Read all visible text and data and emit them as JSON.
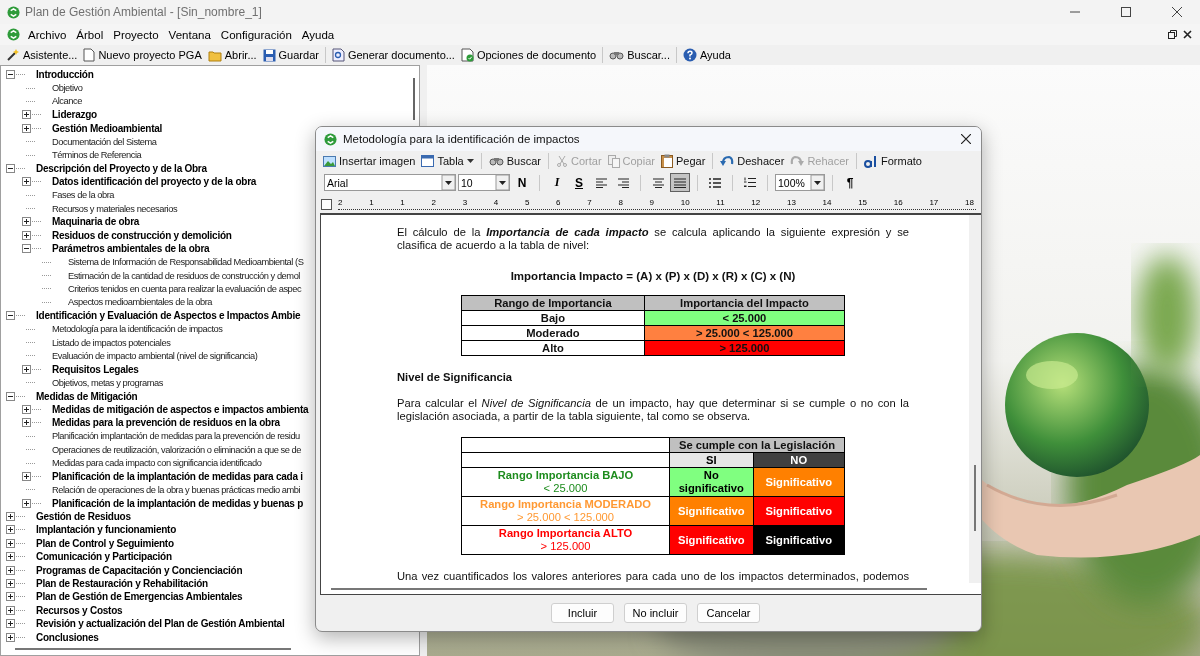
{
  "window": {
    "title": "Plan de Gestión Ambiental - [Sin_nombre_1]"
  },
  "menu": [
    "Archivo",
    "Árbol",
    "Proyecto",
    "Ventana",
    "Configuración",
    "Ayuda"
  ],
  "toolbar": [
    {
      "label": "Asistente...",
      "separator_before": false
    },
    {
      "label": "Nuevo proyecto PGA",
      "separator_before": false
    },
    {
      "label": "Abrir...",
      "separator_before": false
    },
    {
      "label": "Guardar",
      "separator_before": false
    },
    {
      "label": "Generar documento...",
      "separator_before": true
    },
    {
      "label": "Opciones de documento",
      "separator_before": false
    },
    {
      "label": "Buscar...",
      "separator_before": true
    },
    {
      "label": "Ayuda",
      "separator_before": true
    }
  ],
  "tree": [
    {
      "label": "Introducción",
      "expanded": true,
      "children": [
        {
          "label": "Objetivo"
        },
        {
          "label": "Alcance"
        },
        {
          "label": "Liderazgo",
          "expanded": false
        },
        {
          "label": "Gestión Medioambiental",
          "expanded": false
        },
        {
          "label": "Documentación del Sistema"
        },
        {
          "label": "Términos de Referencia"
        }
      ]
    },
    {
      "label": "Descripción del Proyecto y de la Obra",
      "expanded": true,
      "children": [
        {
          "label": "Datos identificación del proyecto y de la obra",
          "expanded": false
        },
        {
          "label": "Fases de la obra"
        },
        {
          "label": "Recursos y materiales necesarios"
        },
        {
          "label": "Maquinaria de obra",
          "expanded": false
        },
        {
          "label": "Residuos de construcción y demolición",
          "expanded": false
        },
        {
          "label": "Parámetros ambientales de la obra",
          "expanded": true,
          "children": [
            {
              "label": "Sistema de Información de Responsabilidad Medioambiental (S"
            },
            {
              "label": "Estimación de la cantidad de residuos de construcción y demol"
            },
            {
              "label": "Criterios tenidos en cuenta para realizar la evaluación de aspec"
            },
            {
              "label": "Aspectos medioambientales de la obra"
            }
          ]
        }
      ]
    },
    {
      "label": "Identificación y Evaluación de Aspectos e Impactos Ambie",
      "expanded": true,
      "children": [
        {
          "label": "Metodología para la identificación de impactos"
        },
        {
          "label": "Listado de impactos potenciales"
        },
        {
          "label": "Evaluación de impacto ambiental (nivel de significancia)"
        },
        {
          "label": "Requisitos Legales",
          "expanded": false
        },
        {
          "label": "Objetivos, metas y programas"
        }
      ]
    },
    {
      "label": "Medidas de Mitigación",
      "expanded": true,
      "children": [
        {
          "label": "Medidas de mitigación de aspectos e impactos ambienta",
          "expanded": false
        },
        {
          "label": "Medidas para la prevención de residuos en la obra",
          "expanded": false
        },
        {
          "label": "Planificación implantación de medidas para la prevención de residu"
        },
        {
          "label": "Operaciones de reutilización, valorización o eliminación a que se de"
        },
        {
          "label": "Medidas para cada impacto con significancia identificado"
        },
        {
          "label": "Planificación de la implantación de medidas para cada i",
          "expanded": false
        },
        {
          "label": "Relación de operaciones de la obra y buenas prácticas medio ambi"
        },
        {
          "label": "Planificación de la implantación de medidas y buenas p",
          "expanded": false
        }
      ]
    },
    {
      "label": "Gestión de Residuos",
      "expanded": false
    },
    {
      "label": "Implantación y funcionamiento",
      "expanded": false
    },
    {
      "label": "Plan de Control y Seguimiento",
      "expanded": false
    },
    {
      "label": "Comunicación y Participación",
      "expanded": false
    },
    {
      "label": "Programas de Capacitación y Concienciación",
      "expanded": false
    },
    {
      "label": "Plan de Restauración y Rehabilitación",
      "expanded": false
    },
    {
      "label": "Plan de Gestión de Emergencias Ambientales",
      "expanded": false
    },
    {
      "label": "Recursos y Costos",
      "expanded": false
    },
    {
      "label": "Revisión y actualización del Plan de Gestión Ambiental",
      "expanded": false
    },
    {
      "label": "Conclusiones",
      "expanded": false
    }
  ],
  "dialog": {
    "title": "Metodología para la identificación de impactos",
    "toolbar": [
      {
        "label": "Insertar imagen",
        "disabled": false,
        "dropdown": false,
        "separator_before": false
      },
      {
        "label": "Tabla",
        "disabled": false,
        "dropdown": true,
        "separator_before": false
      },
      {
        "label": "Buscar",
        "disabled": false,
        "dropdown": false,
        "separator_before": true
      },
      {
        "label": "Cortar",
        "disabled": true,
        "dropdown": false,
        "separator_before": true
      },
      {
        "label": "Copiar",
        "disabled": true,
        "dropdown": false,
        "separator_before": false
      },
      {
        "label": "Pegar",
        "disabled": false,
        "dropdown": false,
        "separator_before": false
      },
      {
        "label": "Deshacer",
        "disabled": false,
        "dropdown": false,
        "separator_before": true
      },
      {
        "label": "Rehacer",
        "disabled": true,
        "dropdown": false,
        "separator_before": false
      },
      {
        "label": "Formato",
        "disabled": false,
        "dropdown": false,
        "separator_before": true
      }
    ],
    "format_bar": [
      {
        "kind": "combo",
        "value": "Arial"
      },
      {
        "kind": "combo",
        "value": "10"
      },
      {
        "kind": "glyph",
        "text": "N",
        "selected": false
      },
      {
        "kind": "separator"
      },
      {
        "kind": "glyph",
        "text": "I",
        "selected": false
      },
      {
        "kind": "glyph",
        "text": "S",
        "selected": false
      },
      {
        "kind": "alignleft",
        "selected": false
      },
      {
        "kind": "alignright",
        "selected": false
      },
      {
        "kind": "separator"
      },
      {
        "kind": "aligncenter",
        "selected": false
      },
      {
        "kind": "justify",
        "selected": true
      },
      {
        "kind": "separator"
      },
      {
        "kind": "bullets",
        "selected": false
      },
      {
        "kind": "separator"
      },
      {
        "kind": "numbering",
        "selected": false
      },
      {
        "kind": "separator"
      },
      {
        "kind": "combo",
        "value": "100%"
      },
      {
        "kind": "separator"
      },
      {
        "kind": "glyph",
        "text": "¶",
        "selected": false
      }
    ],
    "ruler": [
      "2",
      "1",
      "1",
      "2",
      "3",
      "4",
      "5",
      "6",
      "7",
      "8",
      "9",
      "10",
      "11",
      "12",
      "13",
      "14",
      "15",
      "16",
      "17",
      "18"
    ],
    "document": {
      "intro": "El cálculo de la **Importancia de cada impacto** se calcula aplicando la siguiente expresión y se clasifica de acuerdo a la tabla de nivel:",
      "formula": "Importancia Impacto = (A) x (P) x (D) x (R) x (C) x (N)",
      "table1": {
        "columns": [
          "Rango de Importancia",
          "Importancia del Impacto"
        ],
        "rows": [
          {
            "range": "Bajo",
            "value": "< 25.000",
            "color": "#80ff80"
          },
          {
            "range": "Moderado",
            "value": "> 25.000  < 125.000",
            "color": "#ff8040"
          },
          {
            "range": "Alto",
            "value": "> 125.000",
            "color": "#ff0000"
          }
        ]
      },
      "heading": "Nivel de Significancia",
      "paragraph": "Para calcular el *Nivel de Significancia* de un impacto, hay que determinar si se cumple o no con la legislación asociada, a partir de la tabla siguiente, tal como se observa.",
      "table2": {
        "header": "Se cumple con  la Legislación",
        "columns": [
          {
            "label": "SI",
            "color": "#e6e6e6"
          },
          {
            "label": "NO",
            "color": "#404040"
          }
        ],
        "rows": [
          {
            "label": "Rango Importancia BAJO",
            "range": "< 25.000",
            "color": "#1e8c1e",
            "cells": [
              {
                "text": "No significativo",
                "color": "#80ff80"
              },
              {
                "text": "Significativo",
                "color": "#ff8000"
              }
            ]
          },
          {
            "label": "Rango Importancia MODERADO",
            "range": "> 25.000 < 125.000",
            "color": "#ff9933",
            "cells": [
              {
                "text": "Significativo",
                "color": "#ff8000"
              },
              {
                "text": "Significativo",
                "color": "#ff0000"
              }
            ]
          },
          {
            "label": "Rango Importancia ALTO",
            "range": "> 125.000",
            "color": "#ff0000",
            "cells": [
              {
                "text": "Significativo",
                "color": "#ff0000"
              },
              {
                "text": "Significativo",
                "color": "#000000"
              }
            ]
          }
        ]
      },
      "closing": "Una vez cuantificados los valores anteriores para cada uno de los impactos determinados, podemos"
    },
    "buttons": [
      "Incluir",
      "No incluir",
      "Cancelar"
    ]
  }
}
